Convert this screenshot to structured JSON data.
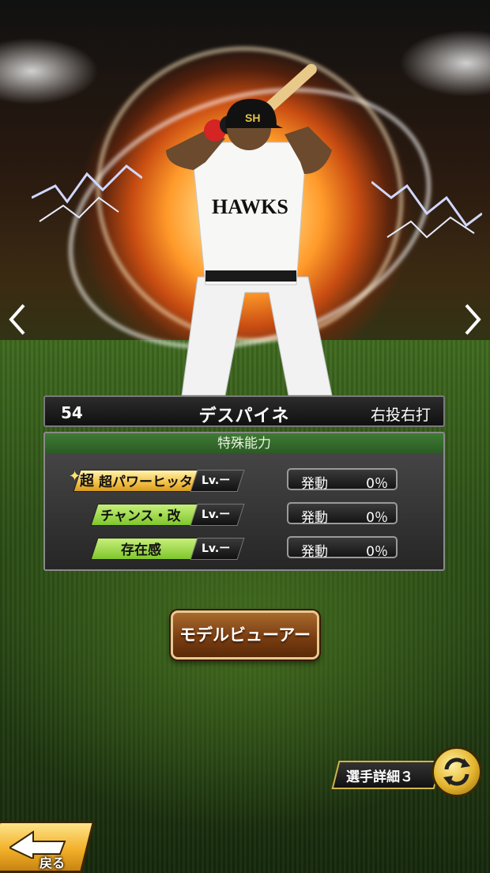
{
  "player": {
    "number": "54",
    "name": "デスパイネ",
    "handedness": "右投右打",
    "jersey_text": "HAWKS",
    "cap_logo": "SH"
  },
  "abilities": {
    "header": "特殊能力",
    "items": [
      {
        "name": "超パワーヒッター",
        "prefix": "超",
        "level": "Lv.ー",
        "status_label": "発動",
        "status_value": "0％",
        "tier": "super"
      },
      {
        "name": "チャンス・改",
        "level": "Lv.ー",
        "status_label": "発動",
        "status_value": "0％",
        "tier": "normal"
      },
      {
        "name": "存在感",
        "level": "Lv.ー",
        "status_label": "発動",
        "status_value": "0％",
        "tier": "normal"
      }
    ]
  },
  "buttons": {
    "model_viewer": "モデルビューアー",
    "player_detail": "選手詳細３",
    "back": "戻る"
  },
  "icons": {
    "prev": "chevron-left-icon",
    "next": "chevron-right-icon",
    "cycle": "cycle-arrows-icon",
    "back": "back-arrow-icon"
  },
  "colors": {
    "ability_green": "#7fc62c",
    "ability_gold": "#f3c44d",
    "header_green": "#3f7a35",
    "button_brown": "#7a3e12"
  }
}
